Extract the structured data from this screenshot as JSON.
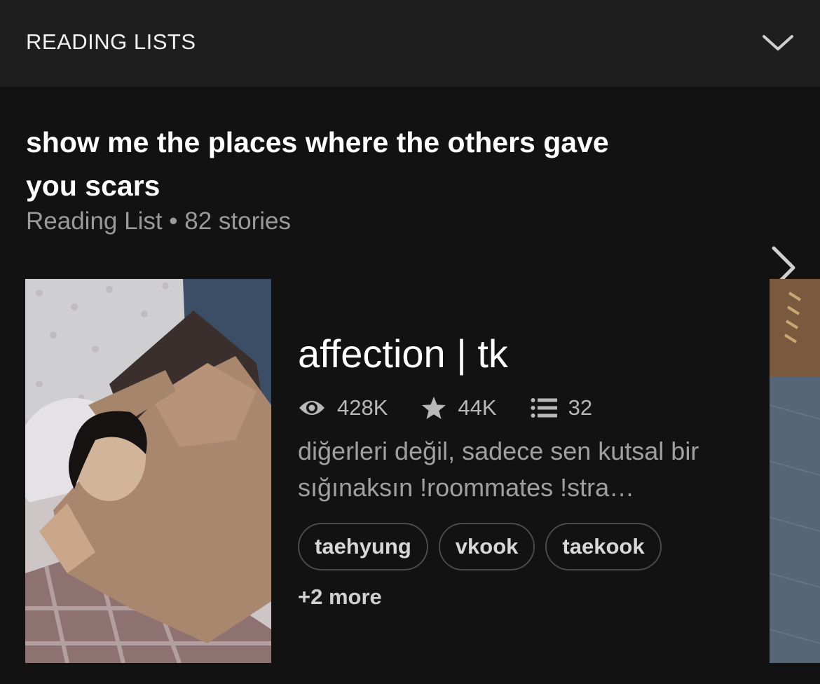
{
  "header": {
    "title": "READING LISTS"
  },
  "reading_list": {
    "title": "show me the places where the others gave you scars",
    "meta": "Reading List • 82 stories"
  },
  "story": {
    "title": "affection | tk",
    "stats": {
      "views": "428K",
      "votes": "44K",
      "parts": "32"
    },
    "description": "diğerleri değil, sadece sen kutsal bir sığınaksın !roommates !stra…",
    "tags": [
      "taehyung",
      "vkook",
      "taekook"
    ],
    "more_tags": "+2 more"
  },
  "icons": {
    "collapse": "chevron-down-icon",
    "open": "chevron-right-icon",
    "views": "eye-icon",
    "votes": "star-icon",
    "parts": "list-icon"
  }
}
